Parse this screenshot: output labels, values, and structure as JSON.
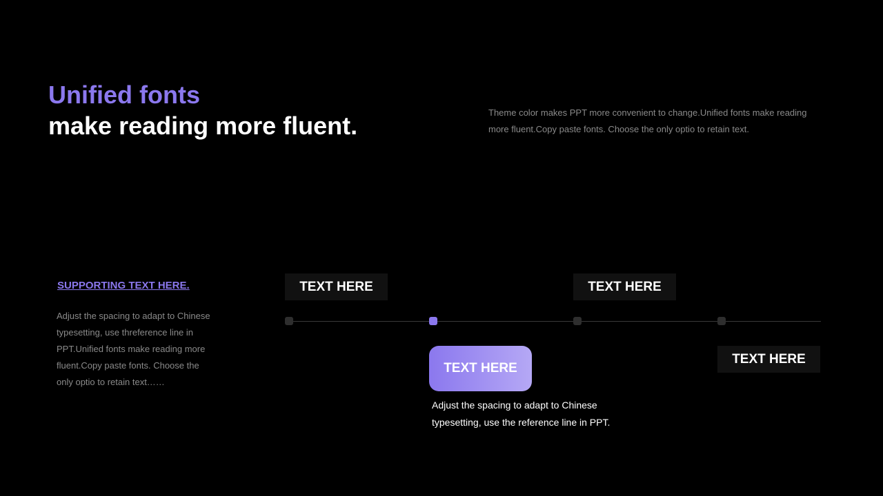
{
  "header": {
    "title_accent": "Unified fonts",
    "title_main": "make reading more fluent.",
    "intro": "Theme color makes PPT more convenient to change.Unified fonts make reading more fluent.Copy paste fonts. Choose the only optio to retain text."
  },
  "support": {
    "heading": "SUPPORTING TEXT HERE.",
    "body": "Adjust the spacing to adapt to Chinese typesetting, use threference line in PPT.Unified fonts make reading more fluent.Copy paste fonts. Choose the only optio to retain text……"
  },
  "timeline": {
    "active_step": 2,
    "steps": [
      {
        "label": "TEXT HERE"
      },
      {
        "label": "TEXT HERE",
        "caption": "Adjust the spacing to adapt to Chinese typesetting, use the reference line in PPT."
      },
      {
        "label": "TEXT HERE"
      },
      {
        "label": "TEXT HERE"
      }
    ]
  },
  "colors": {
    "background": "#000000",
    "accent": "#8b78ee",
    "accent_light": "#b5a8f5",
    "muted_text": "#8a8a8a",
    "label_box": "#111111",
    "dot_inactive": "#2e2e2e",
    "line": "#3a3a3a"
  }
}
